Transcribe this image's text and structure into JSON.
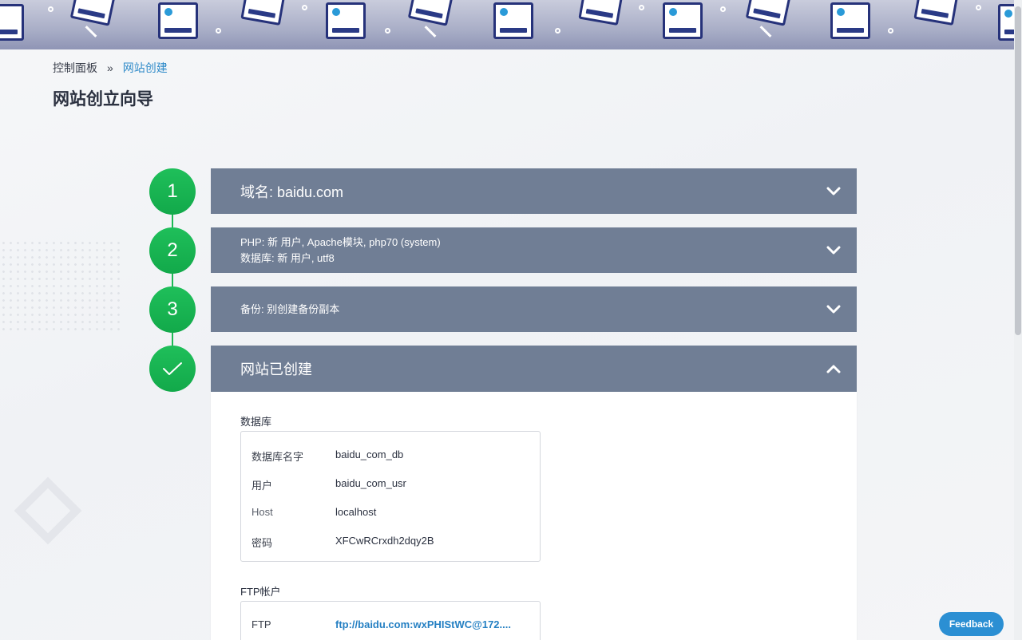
{
  "breadcrumb": {
    "root": "控制面板",
    "separator": "»",
    "current": "网站创建"
  },
  "page": {
    "title": "网站创立向导"
  },
  "steps": [
    {
      "badge": "1",
      "title": "域名: baidu.com"
    },
    {
      "badge": "2",
      "line1": "PHP: 新 用户, Apache模块, php70 (system)",
      "line2": "数据库: 新 用户, utf8"
    },
    {
      "badge": "3",
      "title": "备份: 别创建备份副本"
    },
    {
      "badge": "✓",
      "title": "网站已创建"
    }
  ],
  "database": {
    "label": "数据库",
    "rows": [
      {
        "key": "数据库名字",
        "value": "baidu_com_db"
      },
      {
        "key": "用户",
        "value": "baidu_com_usr"
      },
      {
        "key": "Host",
        "value": "localhost"
      },
      {
        "key": "密码",
        "value": "XFCwRCrxdh2dqy2B"
      }
    ]
  },
  "ftp": {
    "label": "FTP帐户",
    "rows": [
      {
        "key": "FTP",
        "value": "ftp://baidu.com:wxPHIStWC@172...."
      }
    ]
  },
  "feedback": {
    "label": "Feedback"
  },
  "colors": {
    "step_green": "#1db954",
    "panel": "#707e95",
    "link": "#2580c3",
    "feedback": "#2b8fd3"
  }
}
